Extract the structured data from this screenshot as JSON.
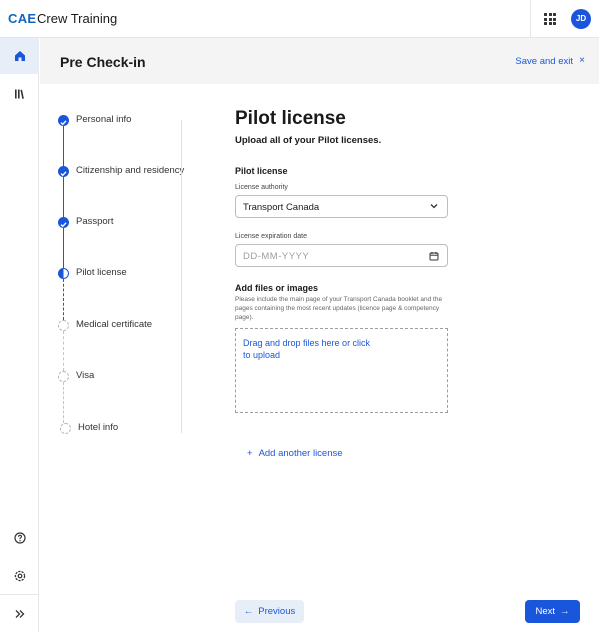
{
  "app": {
    "brand": "CAE",
    "title": "Crew Training"
  },
  "user": {
    "initials": "JD"
  },
  "header": {
    "title": "Pre Check-in",
    "save_exit": "Save and exit",
    "close_glyph": "×"
  },
  "colors": {
    "accent": "#1a56db",
    "header_bg": "#f4f4f4",
    "rail_active_bg": "#e8eef8"
  },
  "rail": {
    "items": [
      {
        "icon": "home-icon",
        "active": true
      },
      {
        "icon": "library-icon",
        "active": false
      },
      {
        "icon": "help-icon",
        "active": false
      },
      {
        "icon": "settings-icon",
        "active": false
      },
      {
        "icon": "expand-icon",
        "active": false
      }
    ]
  },
  "stepper": {
    "steps": [
      {
        "label": "Personal info",
        "status": "done"
      },
      {
        "label": "Citizenship and residency",
        "status": "done"
      },
      {
        "label": "Passport",
        "status": "done"
      },
      {
        "label": "Pilot license",
        "status": "current"
      },
      {
        "label": "Medical certificate",
        "status": "todo"
      },
      {
        "label": "Visa",
        "status": "todo"
      },
      {
        "label": "Hotel info",
        "status": "todo"
      }
    ]
  },
  "form": {
    "title": "Pilot license",
    "subtitle": "Upload all of your Pilot licenses.",
    "section": "Pilot license",
    "authority_label": "License authority",
    "authority_value": "Transport Canada",
    "expiration_label": "License expiration date",
    "expiration_placeholder": "DD-MM-YYYY",
    "upload_title": "Add files or images",
    "upload_desc": "Please include the main page of your Transport Canada booklet and the pages containing the most recent updates (licence page & competency page).",
    "dropzone_text": "Drag and drop files here or click to upload",
    "add_another": "Add another license"
  },
  "footer": {
    "previous": "Previous",
    "next": "Next"
  }
}
